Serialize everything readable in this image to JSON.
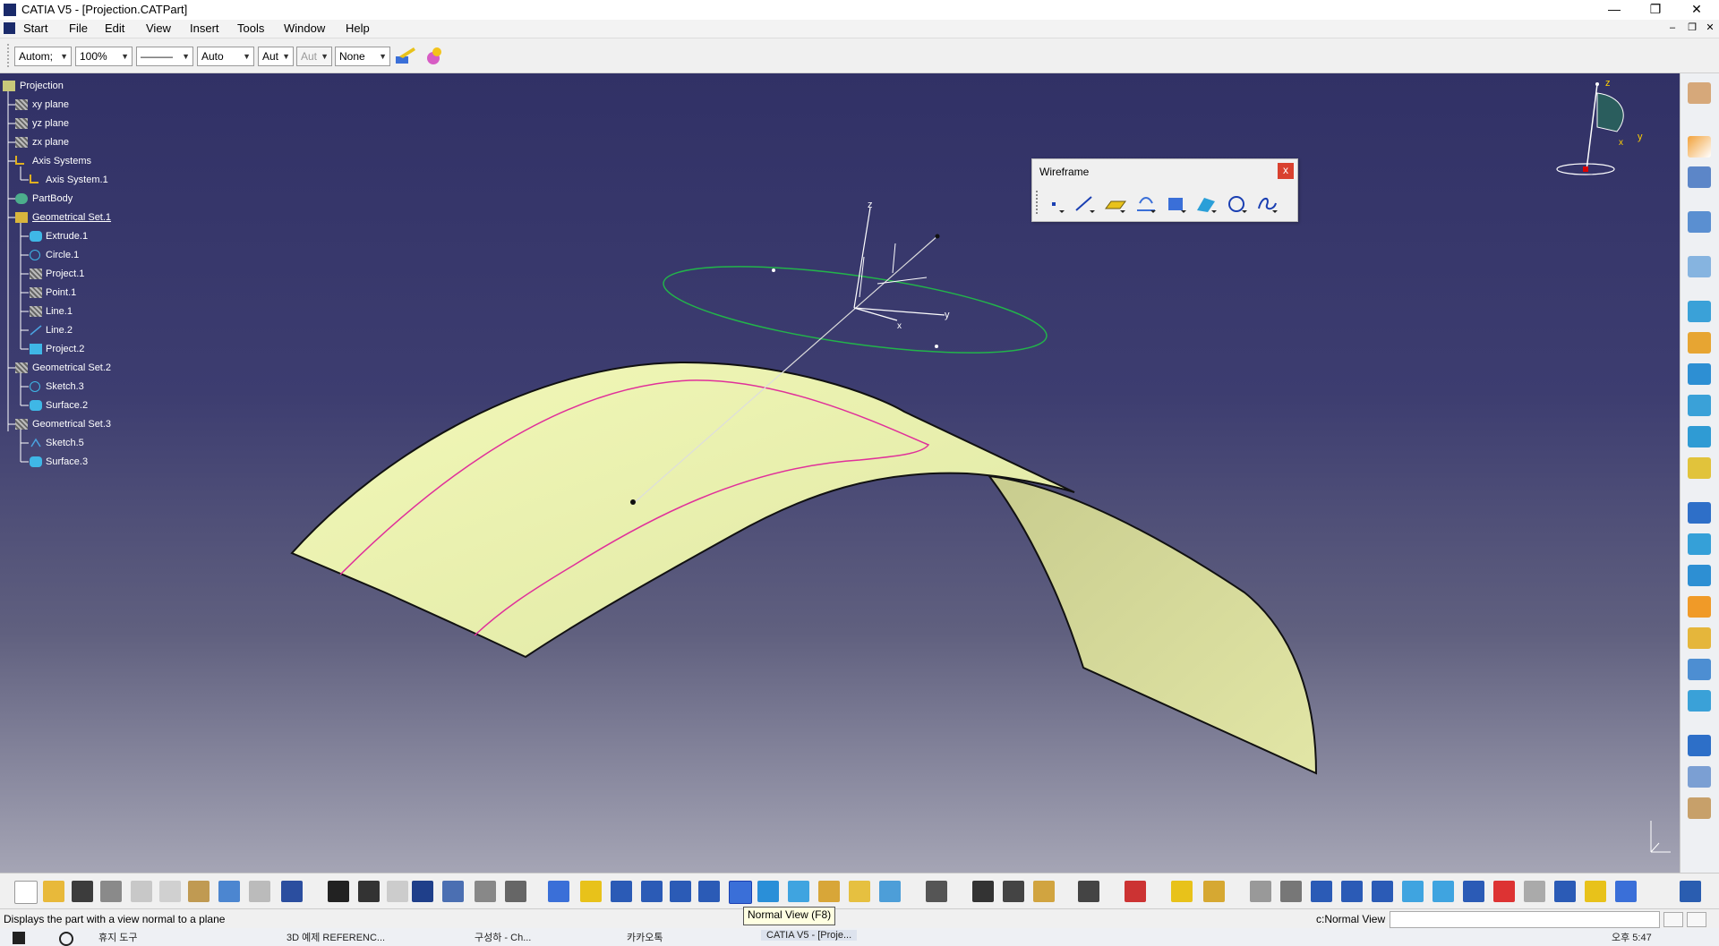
{
  "window": {
    "title": "CATIA V5 - [Projection.CATPart]"
  },
  "menu": [
    {
      "label": "Start",
      "accel": "S"
    },
    {
      "label": "File",
      "accel": "F"
    },
    {
      "label": "Edit",
      "accel": "E"
    },
    {
      "label": "View",
      "accel": "V"
    },
    {
      "label": "Insert",
      "accel": "I"
    },
    {
      "label": "Tools",
      "accel": "T"
    },
    {
      "label": "Window",
      "accel": "W"
    },
    {
      "label": "Help",
      "accel": "H"
    }
  ],
  "toolbar": {
    "color_value": "Autom;",
    "transparency_value": "100%",
    "linetype_value": "———",
    "lineweight_value": "Auto",
    "layer_value": "Aut",
    "layer2_value": "Aut",
    "layer_filter_value": "None"
  },
  "tree": [
    {
      "label": "Projection",
      "icon": "part-icon",
      "underline": false
    },
    {
      "label": "xy plane",
      "icon": "plane-icon",
      "underline": false
    },
    {
      "label": "yz plane",
      "icon": "plane-icon",
      "underline": false
    },
    {
      "label": "zx plane",
      "icon": "plane-icon",
      "underline": false
    },
    {
      "label": "Axis Systems",
      "icon": "axis-systems-icon",
      "underline": false
    },
    {
      "label": "Axis System.1",
      "icon": "axis-system-icon",
      "underline": false
    },
    {
      "label": "PartBody",
      "icon": "partbody-icon",
      "underline": false
    },
    {
      "label": "Geometrical Set.1",
      "icon": "geometrical-set-icon",
      "underline": true
    },
    {
      "label": "Extrude.1",
      "icon": "extrude-icon",
      "underline": false
    },
    {
      "label": "Circle.1",
      "icon": "circle-icon",
      "underline": false
    },
    {
      "label": "Project.1",
      "icon": "project-icon",
      "underline": false
    },
    {
      "label": "Point.1",
      "icon": "point-icon",
      "underline": false
    },
    {
      "label": "Line.1",
      "icon": "line-icon",
      "underline": false
    },
    {
      "label": "Line.2",
      "icon": "line-icon",
      "underline": false
    },
    {
      "label": "Project.2",
      "icon": "project-icon",
      "underline": false
    },
    {
      "label": "Geometrical Set.2",
      "icon": "geometrical-set-icon",
      "underline": false
    },
    {
      "label": "Sketch.3",
      "icon": "sketch-icon",
      "underline": false
    },
    {
      "label": "Surface.2",
      "icon": "surface-icon",
      "underline": false
    },
    {
      "label": "Geometrical Set.3",
      "icon": "geometrical-set-icon",
      "underline": false
    },
    {
      "label": "Sketch.5",
      "icon": "sketch-icon",
      "underline": false
    },
    {
      "label": "Surface.3",
      "icon": "surface-icon",
      "underline": false
    }
  ],
  "wireframe": {
    "title": "Wireframe",
    "close_label": "x",
    "tools": [
      "point-icon",
      "line-icon",
      "plane-icon",
      "projection-icon",
      "intersection-icon",
      "offset-icon",
      "circle-icon",
      "spline-icon"
    ]
  },
  "compass": {
    "x_label": "x",
    "y_label": "y",
    "z_label": "z"
  },
  "axis_triad": {
    "z": "z",
    "y": "y",
    "x": "x"
  },
  "status": {
    "message": "Displays the part with a view normal to a plane",
    "command_label": "c:Normal View"
  },
  "tooltip": "Normal View (F8)",
  "taskbar": [
    {
      "label": "휴지 도구"
    },
    {
      "label": "3D 예제 REFERENC..."
    },
    {
      "label": "구성하 - Ch..."
    },
    {
      "label": "카카오톡"
    },
    {
      "label": "CATIA V5 - [Proje..."
    }
  ],
  "clock": "오후 5:47",
  "colors": {
    "viewport_top": "#313166",
    "viewport_bottom": "#a5a5b5",
    "surface": "#e9f0ae",
    "projection_curve": "#e0309a",
    "circle": "#22b44a"
  }
}
